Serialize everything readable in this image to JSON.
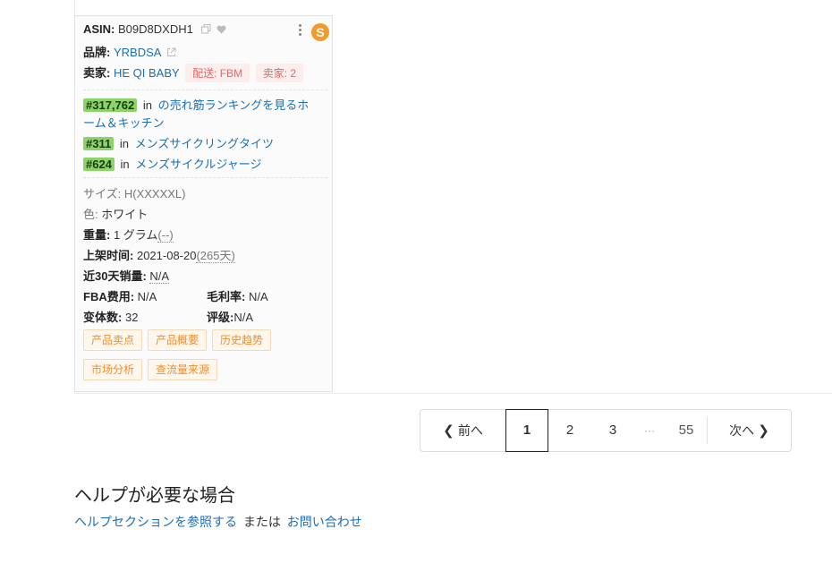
{
  "product": {
    "asin_label": "ASIN:",
    "asin": "B09D8DXDH1",
    "brand_label": "品牌:",
    "brand": "YRBDSA",
    "seller_label": "卖家:",
    "seller": "HE QI BABY",
    "ship_badge": "配送: FBM",
    "seller_count_badge": "卖家: 2",
    "logo_letter": "S",
    "ranks": [
      {
        "rank": "#317,762",
        "in": "in",
        "category_line1": "の売れ筋ランキングを見るホ",
        "category_line2": "ーム＆キッチン"
      },
      {
        "rank": "#311",
        "in": "in",
        "category": "メンズサイクリングタイツ"
      },
      {
        "rank": "#624",
        "in": "in",
        "category": "メンズサイクルジャージ"
      }
    ],
    "size_label": "サイズ:",
    "size": "H(XXXXXL)",
    "color_label": "色:",
    "color": "ホワイト",
    "weight_label": "重量:",
    "weight": "1 グラム",
    "weight_extra": "(--)",
    "listed_label": "上架时间:",
    "listed_date": "2021-08-20",
    "listed_days": "(265天)",
    "sales_label": "近30天销量:",
    "sales": "N/A",
    "fba_label": "FBA费用:",
    "fba": "N/A",
    "margin_label": "毛利率:",
    "margin": "N/A",
    "variants_label": "变体数:",
    "variants": "32",
    "rating_label": "评级:",
    "rating": "N/A",
    "actions": [
      "产品卖点",
      "产品概要",
      "历史趋势",
      "市场分析",
      "查流量来源"
    ]
  },
  "pagination": {
    "prev": "前へ",
    "pages": [
      "1",
      "2",
      "3"
    ],
    "ellipsis": "···",
    "last": "55",
    "next": "次へ",
    "current": "1"
  },
  "help": {
    "title": "ヘルプが必要な場合",
    "link1": "ヘルプセクションを参照する",
    "or": "または",
    "link2": "お問い合わせ"
  },
  "colors": {
    "accent_link": "#1a6fb5",
    "rank_badge": "#8cd46a",
    "orange": "#ef8d2d"
  }
}
